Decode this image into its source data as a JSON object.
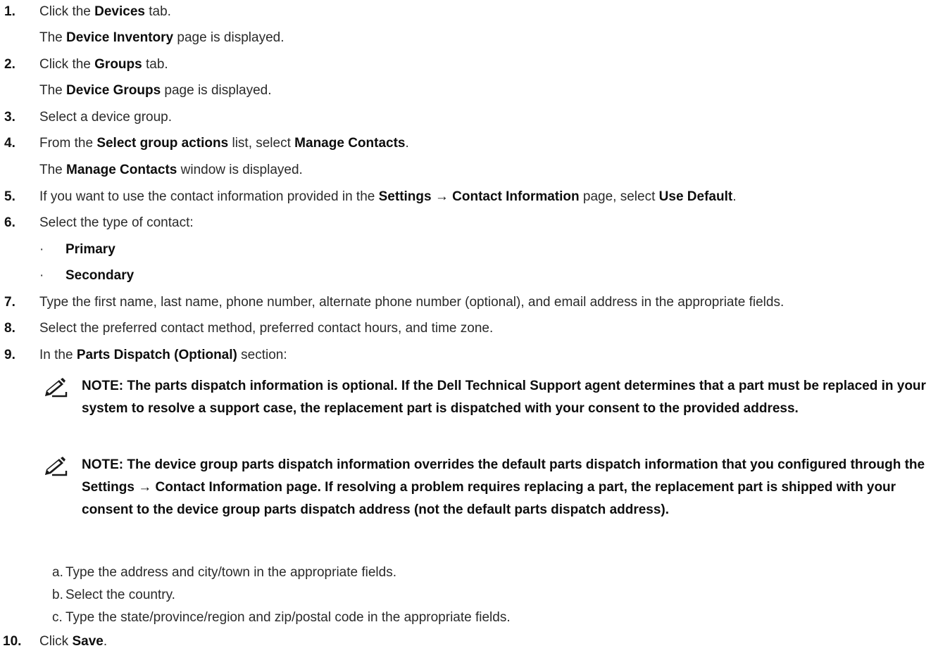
{
  "steps": [
    {
      "num": "1.",
      "parts": [
        "Click the ",
        "Devices",
        " tab."
      ],
      "result": [
        "The ",
        "Device Inventory",
        " page is displayed."
      ]
    },
    {
      "num": "2.",
      "parts": [
        "Click the ",
        "Groups",
        " tab."
      ],
      "result": [
        "The ",
        "Device Groups",
        " page is displayed."
      ]
    },
    {
      "num": "3.",
      "text": "Select a device group."
    },
    {
      "num": "4.",
      "parts": [
        "From the ",
        "Select group actions",
        " list, select ",
        "Manage Contacts",
        "."
      ],
      "result": [
        "The ",
        "Manage Contacts",
        " window is displayed."
      ]
    },
    {
      "num": "5.",
      "parts": [
        "If you want to use the contact information provided in the ",
        "Settings → Contact Information",
        " page, select ",
        "Use Default",
        "."
      ]
    },
    {
      "num": "6.",
      "text": "Select the type of contact:",
      "bullets": [
        "Primary",
        "Secondary"
      ]
    },
    {
      "num": "7.",
      "text": "Type the first name, last name, phone number, alternate phone number (optional), and email address in the appropriate fields."
    },
    {
      "num": "8.",
      "text": "Select the preferred contact method, preferred contact hours, and time zone."
    },
    {
      "num": "9.",
      "parts": [
        "In the ",
        "Parts Dispatch (Optional)",
        " section:"
      ]
    },
    {
      "num": "10.",
      "parts": [
        "Click ",
        "Save",
        "."
      ]
    }
  ],
  "notes": [
    "NOTE: The parts dispatch information is optional. If the Dell Technical Support agent determines that a part must be replaced in your system to resolve a support case, the replacement part is dispatched with your consent to the provided address.",
    "NOTE: The device group parts dispatch information overrides the default parts dispatch information that you configured through the Settings → Contact Information page. If resolving a problem requires replacing a part, the replacement part is shipped with your consent to the device group parts dispatch address (not the default parts dispatch address)."
  ],
  "substeps": [
    {
      "letter": "a.",
      "text": "Type the address and city/town in the appropriate fields."
    },
    {
      "letter": "b.",
      "text": "Select the country."
    },
    {
      "letter": "c.",
      "text": "Type the state/province/region and zip/postal code in the appropriate fields."
    }
  ],
  "icons": {
    "note": "pencil-note-icon"
  },
  "colors": {
    "text": "#2a2a2a",
    "bold": "#0d0d0d",
    "icon": "#1a1a1a"
  }
}
